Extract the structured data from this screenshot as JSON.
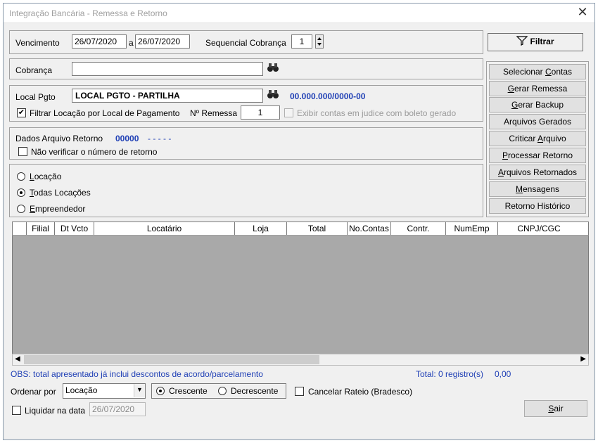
{
  "window": {
    "title": "Integração Bancária - Remessa e Retorno",
    "close_glyph": "✕"
  },
  "top": {
    "vencimento_label": "Vencimento",
    "date_from": "26/07/2020",
    "date_sep": "a",
    "date_to": "26/07/2020",
    "seq_label": "Sequencial Cobrança",
    "seq_value": "1",
    "filter_button": "Filtrar"
  },
  "cobranca": {
    "label": "Cobrança",
    "value": ""
  },
  "local": {
    "label": "Local Pgto",
    "value": "LOCAL PGTO - PARTILHA",
    "code": "00.000.000/0000-00",
    "filter_check_label": "Filtrar Locação por Local de Pagamento",
    "filter_checked": true,
    "remessa_label": "Nº Remessa",
    "remessa_value": "1",
    "judice_label": "Exibir contas em judice com boleto gerado"
  },
  "retorno": {
    "label": "Dados Arquivo Retorno",
    "number": "00000",
    "dashes": "- - - - -",
    "no_verify_label": "Não verificar o número de retorno"
  },
  "scope": {
    "options": [
      {
        "label_u": "L",
        "label_rest": "ocação",
        "selected": false
      },
      {
        "label_u": "T",
        "label_rest": "odas Locações",
        "selected": true
      },
      {
        "label_u": "E",
        "label_rest": "mpreendedor",
        "selected": false
      }
    ]
  },
  "side_buttons": [
    {
      "pre": "Selecionar ",
      "u": "C",
      "post": "ontas"
    },
    {
      "pre": "",
      "u": "G",
      "post": "erar Remessa"
    },
    {
      "pre": "",
      "u": "G",
      "post": "erar Backup"
    },
    {
      "pre": "Arquivos Gerados",
      "u": "",
      "post": ""
    },
    {
      "pre": "Criticar ",
      "u": "A",
      "post": "rquivo"
    },
    {
      "pre": "",
      "u": "P",
      "post": "rocessar Retorno"
    },
    {
      "pre": "",
      "u": "A",
      "post": "rquivos Retornados"
    },
    {
      "pre": "",
      "u": "M",
      "post": "ensagens"
    },
    {
      "pre": "Retorno Histórico",
      "u": "",
      "post": ""
    }
  ],
  "grid": {
    "columns": [
      "",
      "Filial",
      "Dt Vcto",
      "Locatário",
      "Loja",
      "Total",
      "No.Contas",
      "Contr.",
      "NumEmp",
      "CNPJ/CGC"
    ]
  },
  "footer": {
    "obs": "OBS: total apresentado já inclui descontos de acordo/parcelamento",
    "total_label": "Total: 0 registro(s)",
    "total_value": "0,00",
    "order_label": "Ordenar por",
    "order_value": "Locação",
    "asc_label": "Crescente",
    "desc_label": "Decrescente",
    "asc_selected": true,
    "cancel_rateio_label": "Cancelar Rateio (Bradesco)",
    "liquidar_label": "Liquidar na data",
    "liquidar_date": "26/07/2020",
    "exit_u": "S",
    "exit_rest": "air"
  }
}
